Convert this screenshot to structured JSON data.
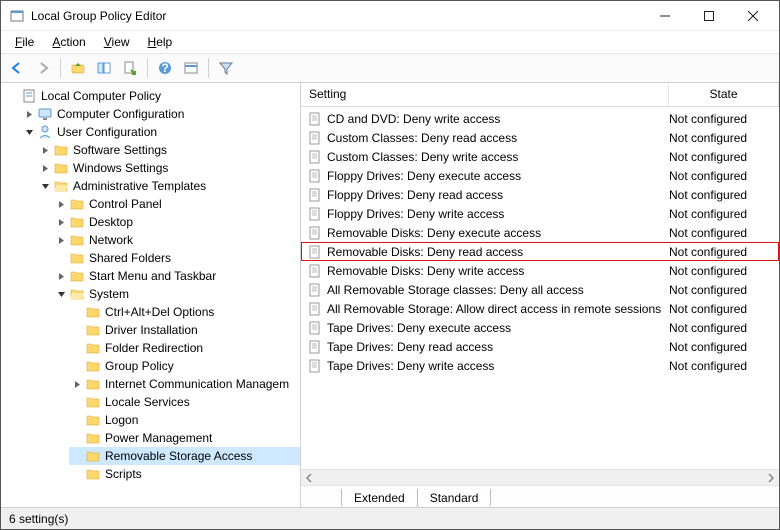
{
  "window": {
    "title": "Local Group Policy Editor"
  },
  "menubar": [
    {
      "label": "File",
      "key": "F"
    },
    {
      "label": "Action",
      "key": "A"
    },
    {
      "label": "View",
      "key": "V"
    },
    {
      "label": "Help",
      "key": "H"
    }
  ],
  "tree": {
    "root": {
      "label": "Local Computer Policy"
    },
    "computer_config": {
      "label": "Computer Configuration"
    },
    "user_config": {
      "label": "User Configuration"
    },
    "software_settings": {
      "label": "Software Settings"
    },
    "windows_settings": {
      "label": "Windows Settings"
    },
    "admin_templates": {
      "label": "Administrative Templates"
    },
    "control_panel": {
      "label": "Control Panel"
    },
    "desktop": {
      "label": "Desktop"
    },
    "network": {
      "label": "Network"
    },
    "shared_folders": {
      "label": "Shared Folders"
    },
    "start_menu": {
      "label": "Start Menu and Taskbar"
    },
    "system": {
      "label": "System"
    },
    "ctrl_alt_del": {
      "label": "Ctrl+Alt+Del Options"
    },
    "driver_install": {
      "label": "Driver Installation"
    },
    "folder_redirect": {
      "label": "Folder Redirection"
    },
    "group_policy": {
      "label": "Group Policy"
    },
    "icm": {
      "label": "Internet Communication Managem"
    },
    "locale": {
      "label": "Locale Services"
    },
    "logon": {
      "label": "Logon"
    },
    "power": {
      "label": "Power Management"
    },
    "removable": {
      "label": "Removable Storage Access"
    },
    "scripts": {
      "label": "Scripts"
    }
  },
  "columns": {
    "setting": "Setting",
    "state": "State"
  },
  "rows": [
    {
      "setting": "CD and DVD: Deny write access",
      "state": "Not configured"
    },
    {
      "setting": "Custom Classes: Deny read access",
      "state": "Not configured"
    },
    {
      "setting": "Custom Classes: Deny write access",
      "state": "Not configured"
    },
    {
      "setting": "Floppy Drives: Deny execute access",
      "state": "Not configured"
    },
    {
      "setting": "Floppy Drives: Deny read access",
      "state": "Not configured"
    },
    {
      "setting": "Floppy Drives: Deny write access",
      "state": "Not configured"
    },
    {
      "setting": "Removable Disks: Deny execute access",
      "state": "Not configured"
    },
    {
      "setting": "Removable Disks: Deny read access",
      "state": "Not configured",
      "highlighted": true
    },
    {
      "setting": "Removable Disks: Deny write access",
      "state": "Not configured"
    },
    {
      "setting": "All Removable Storage classes: Deny all access",
      "state": "Not configured"
    },
    {
      "setting": "All Removable Storage: Allow direct access in remote sessions",
      "state": "Not configured"
    },
    {
      "setting": "Tape Drives: Deny execute access",
      "state": "Not configured"
    },
    {
      "setting": "Tape Drives: Deny read access",
      "state": "Not configured"
    },
    {
      "setting": "Tape Drives: Deny write access",
      "state": "Not configured"
    }
  ],
  "tabs": {
    "extended": "Extended",
    "standard": "Standard"
  },
  "statusbar": {
    "text": "6 setting(s)"
  }
}
